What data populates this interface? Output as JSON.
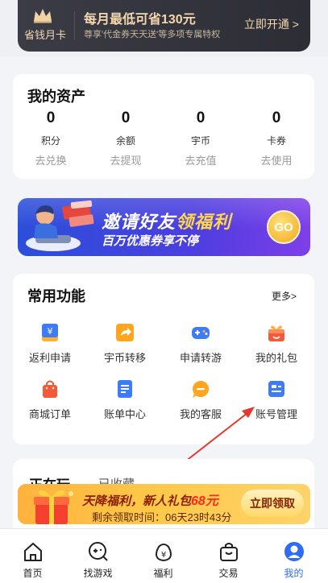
{
  "vip": {
    "card_label": "省钱月卡",
    "title": "每月最低可省130元",
    "subtitle": "尊享'代金券天天送'等多项专属特权",
    "open_label": "立即开通 >"
  },
  "assets": {
    "title": "我的资产",
    "items": [
      {
        "value": "0",
        "name": "积分",
        "action": "去兑换"
      },
      {
        "value": "0",
        "name": "余额",
        "action": "去提现"
      },
      {
        "value": "0",
        "name": "宇币",
        "action": "去充值"
      },
      {
        "value": "0",
        "name": "卡券",
        "action": "去使用"
      }
    ]
  },
  "invite_banner": {
    "title_a": "邀请好友",
    "title_b": "领福利",
    "subtitle": "百万优惠券享不停",
    "go_label": "GO"
  },
  "functions": {
    "title": "常用功能",
    "more_label": "更多>",
    "items": [
      {
        "label": "返利申请",
        "icon": "rebate-icon"
      },
      {
        "label": "宇币转移",
        "icon": "transfer-icon"
      },
      {
        "label": "申请转游",
        "icon": "gamepad-icon"
      },
      {
        "label": "我的礼包",
        "icon": "gift-icon"
      },
      {
        "label": "商城订单",
        "icon": "shopping-bag-icon"
      },
      {
        "label": "账单中心",
        "icon": "bill-icon"
      },
      {
        "label": "我的客服",
        "icon": "customer-service-icon"
      },
      {
        "label": "账号管理",
        "icon": "account-card-icon"
      }
    ]
  },
  "tabs": {
    "active": "正在玩",
    "inactive": "已收藏"
  },
  "promo": {
    "title_a": "天降福利，新人礼包",
    "amount": "68元",
    "time_text": "剩余领取时间：06天23时43分",
    "button_label": "立即领取"
  },
  "nav": {
    "items": [
      {
        "label": "首页",
        "icon": "home-icon"
      },
      {
        "label": "找游戏",
        "icon": "find-game-icon"
      },
      {
        "label": "福利",
        "icon": "welfare-icon"
      },
      {
        "label": "交易",
        "icon": "trade-bag-icon"
      },
      {
        "label": "我的",
        "icon": "profile-icon"
      }
    ],
    "active_index": 4
  },
  "colors": {
    "accent": "#2f6bf5",
    "vip_gold": "#f5d7ae",
    "promo_red": "#ff2a1a",
    "annotation_arrow": "#e8362b"
  }
}
